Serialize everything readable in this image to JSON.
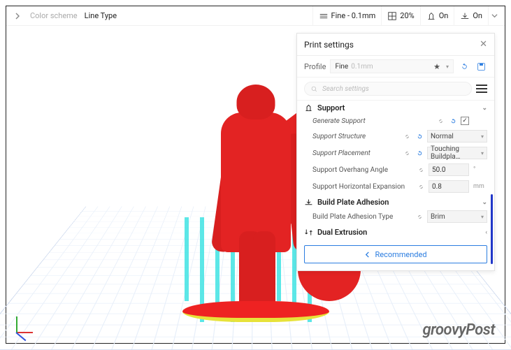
{
  "topbar": {
    "color_scheme_label": "Color scheme",
    "color_scheme_value": "Line Type",
    "quality": {
      "label": "Fine - 0.1mm"
    },
    "infill": {
      "label": "20%"
    },
    "support": {
      "label": "On"
    },
    "adhesion": {
      "label": "On"
    }
  },
  "panel": {
    "title": "Print settings",
    "profile_label": "Profile",
    "profile_value": "Fine",
    "profile_dim": "0.1mm",
    "search_placeholder": "Search settings",
    "sections": {
      "support": {
        "title": "Support",
        "generate": {
          "label": "Generate Support",
          "checked": true
        },
        "structure": {
          "label": "Support Structure",
          "value": "Normal"
        },
        "placement": {
          "label": "Support Placement",
          "value": "Touching Buildpla…"
        },
        "overhang": {
          "label": "Support Overhang Angle",
          "value": "50.0",
          "unit": "°"
        },
        "hexpand": {
          "label": "Support Horizontal Expansion",
          "value": "0.8",
          "unit": "mm"
        }
      },
      "adhesion": {
        "title": "Build Plate Adhesion",
        "type": {
          "label": "Build Plate Adhesion Type",
          "value": "Brim"
        }
      },
      "dual": {
        "title": "Dual Extrusion"
      }
    },
    "recommended": "Recommended"
  },
  "watermark": "groovyPost"
}
